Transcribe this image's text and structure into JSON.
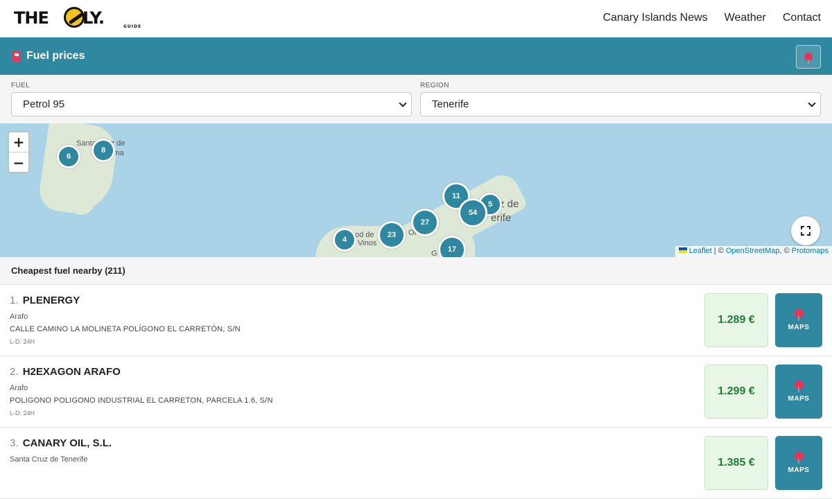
{
  "nav": {
    "logo_left": "THE",
    "logo_right": "NLY.",
    "logo_sub": "GUIDE",
    "links": [
      "Canary Islands News",
      "Weather",
      "Contact"
    ]
  },
  "header": {
    "title": "Fuel prices",
    "icon": "fuel-pump-icon",
    "locate_icon": "map-pin-icon"
  },
  "filters": {
    "fuel_label": "FUEL",
    "fuel_value": "Petrol 95",
    "region_label": "REGION",
    "region_value": "Tenerife"
  },
  "map": {
    "zoom_in": "+",
    "zoom_out": "−",
    "labels": {
      "la_palma_1": "Santa Cruz de",
      "la_palma_2": "La Palma",
      "tenerife_1": "z de",
      "tenerife_2": "erife",
      "icod_1": "od de",
      "icod_2": "Vinos",
      "orotava": "Or",
      "guimar": "G"
    },
    "clusters": [
      "6",
      "8",
      "11",
      "5",
      "54",
      "27",
      "23",
      "4",
      "17"
    ],
    "attribution": {
      "leaflet": "Leaflet",
      "sep1": " | © ",
      "osm": "OpenStreetMap",
      "sep2": ", © ",
      "protomaps": "Protomaps"
    }
  },
  "list": {
    "title": "Cheapest fuel nearby (211)",
    "maps_label": "MAPS",
    "stations": [
      {
        "num": "1.",
        "name": "PLENERGY",
        "town": "Arafo",
        "address": "CALLE CAMINO LA MOLINETA POLÍGONO EL CARRETÓN, S/N",
        "hours": "L-D: 24H",
        "price": "1.289 €"
      },
      {
        "num": "2.",
        "name": "H2EXAGON ARAFO",
        "town": "Arafo",
        "address": "POLIGONO POLIGONO INDUSTRIAL EL CARRETON, PARCELA 1.6, S/N",
        "hours": "L-D: 24H",
        "price": "1.299 €"
      },
      {
        "num": "3.",
        "name": "CANARY OIL, S.L.",
        "town": "Santa Cruz de Tenerife",
        "address": "",
        "hours": "",
        "price": "1.385 €"
      }
    ]
  }
}
